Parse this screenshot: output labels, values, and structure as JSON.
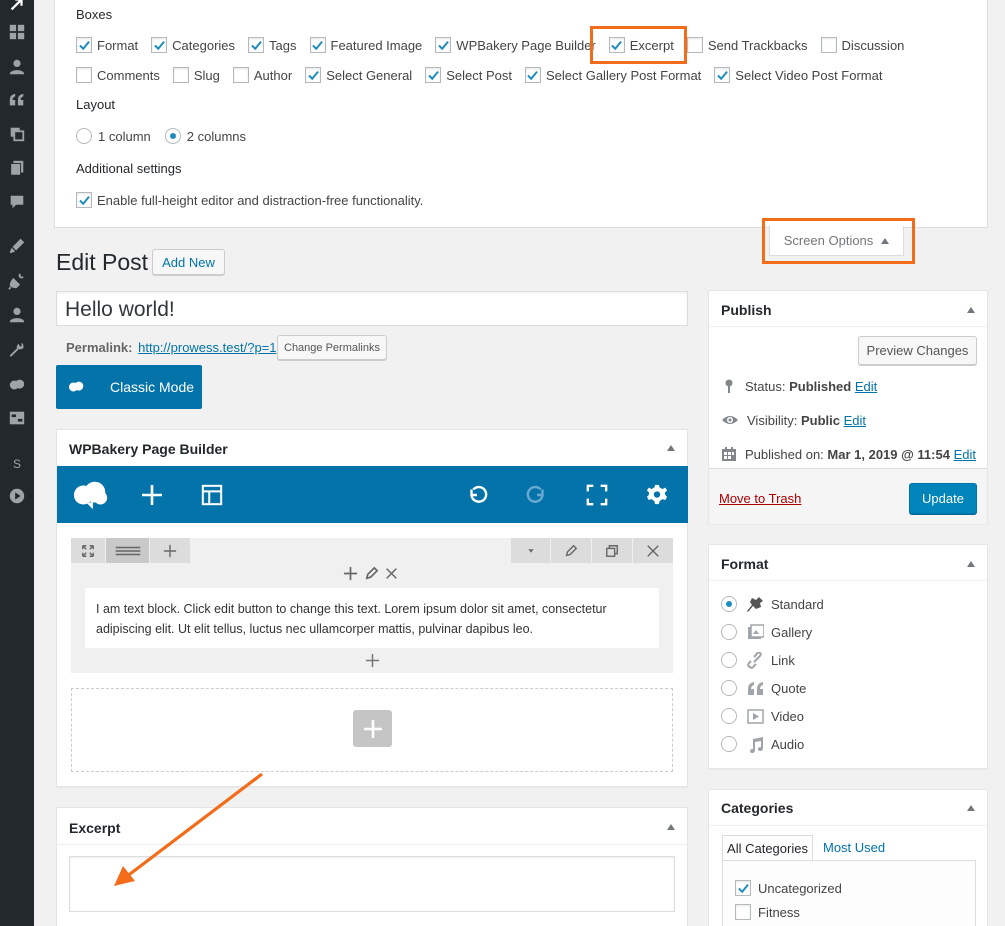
{
  "screen_options": {
    "boxes_heading": "Boxes",
    "boxes_row1": [
      {
        "label": "Format",
        "checked": true
      },
      {
        "label": "Categories",
        "checked": true
      },
      {
        "label": "Tags",
        "checked": true
      },
      {
        "label": "Featured Image",
        "checked": true
      },
      {
        "label": "WPBakery Page Builder",
        "checked": true
      },
      {
        "label": "Excerpt",
        "checked": true
      },
      {
        "label": "Send Trackbacks",
        "checked": false
      },
      {
        "label": "Discussion",
        "checked": false
      }
    ],
    "boxes_row2": [
      {
        "label": "Comments",
        "checked": false
      },
      {
        "label": "Slug",
        "checked": false
      },
      {
        "label": "Author",
        "checked": false
      },
      {
        "label": "Select General",
        "checked": true
      },
      {
        "label": "Select Post",
        "checked": true
      },
      {
        "label": "Select Gallery Post Format",
        "checked": true
      },
      {
        "label": "Select Video Post Format",
        "checked": true
      }
    ],
    "layout_heading": "Layout",
    "layout_options": [
      "1 column",
      "2 columns"
    ],
    "layout_selected": "2 columns",
    "additional_heading": "Additional settings",
    "additional_option": "Enable full-height editor and distraction-free functionality.",
    "additional_checked": true,
    "tab_label": "Screen Options"
  },
  "page": {
    "title": "Edit Post",
    "add_new": "Add New"
  },
  "post": {
    "title_value": "Hello world!",
    "permalink_label": "Permalink:",
    "permalink_url": "http://prowess.test/?p=1",
    "change_permalinks": "Change Permalinks",
    "classic_mode": "Classic Mode"
  },
  "wpbakery": {
    "title": "WPBakery Page Builder",
    "text_block": "I am text block. Click edit button to change this text. Lorem ipsum dolor sit amet, consectetur adipiscing elit. Ut elit tellus, luctus nec ullamcorper mattis, pulvinar dapibus leo."
  },
  "excerpt": {
    "title": "Excerpt",
    "value": ""
  },
  "publish": {
    "title": "Publish",
    "preview": "Preview Changes",
    "status_label": "Status:",
    "status_value": "Published",
    "visibility_label": "Visibility:",
    "visibility_value": "Public",
    "published_label": "Published on:",
    "published_value": "Mar 1, 2019 @ 11:54",
    "edit": "Edit",
    "trash": "Move to Trash",
    "update": "Update"
  },
  "format": {
    "title": "Format",
    "options": [
      "Standard",
      "Gallery",
      "Link",
      "Quote",
      "Video",
      "Audio"
    ],
    "selected": "Standard"
  },
  "categories": {
    "title": "Categories",
    "tab_all": "All Categories",
    "tab_most_used": "Most Used",
    "items": [
      {
        "label": "Uncategorized",
        "checked": true
      },
      {
        "label": "Fitness",
        "checked": false
      }
    ]
  },
  "sidebar_letter": "S",
  "colors": {
    "accent": "#0073aa",
    "annotation": "#f26c1a",
    "admin_bar": "#23282d",
    "vc_bar": "#0473aa"
  }
}
